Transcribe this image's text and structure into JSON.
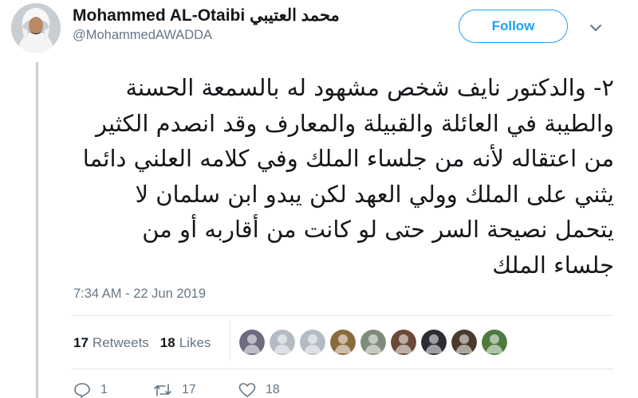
{
  "user": {
    "display_name": "Mohammed AL-Otaibi محمد العتيبي",
    "handle": "@MohammedAWADDA"
  },
  "follow_label": "Follow",
  "tweet": {
    "lines": [
      "٢- والدكتور نايف شخص مشهود له بالسمعة الحسنة",
      "والطيبة في العائلة والقبيلة والمعارف وقد انصدم الكثير",
      "من اعتقاله لأنه من جلساء الملك وفي كلامه العلني دائما",
      "يثني على الملك وولي العهد لكن يبدو ابن سلمان لا",
      "يتحمل نصيحة السر حتى لو كانت من أقاربه أو من",
      "جلساء الملك"
    ],
    "timestamp": "7:34 AM - 22 Jun 2019"
  },
  "stats": {
    "retweets_count": "17",
    "retweets_label": "Retweets",
    "likes_count": "18",
    "likes_label": "Likes"
  },
  "liker_avatar_colors": [
    "#6e6a80",
    "#b3bcc4",
    "#b3bcc4",
    "#8a6a3c",
    "#7f8c7a",
    "#6b4a3a",
    "#2c2c34",
    "#4a3a2a",
    "#4e7a3e"
  ],
  "actions": {
    "reply_count": "1",
    "retweet_count": "17",
    "like_count": "18"
  },
  "icons": {
    "chevron": "chevron-down-icon",
    "reply": "reply-icon",
    "retweet": "retweet-icon",
    "like": "heart-icon"
  },
  "colors": {
    "accent": "#1da1f2",
    "secondary_text": "#657786",
    "primary_text": "#14171a",
    "divider": "#e1e8ed",
    "thread_line": "#c4cfd6"
  }
}
